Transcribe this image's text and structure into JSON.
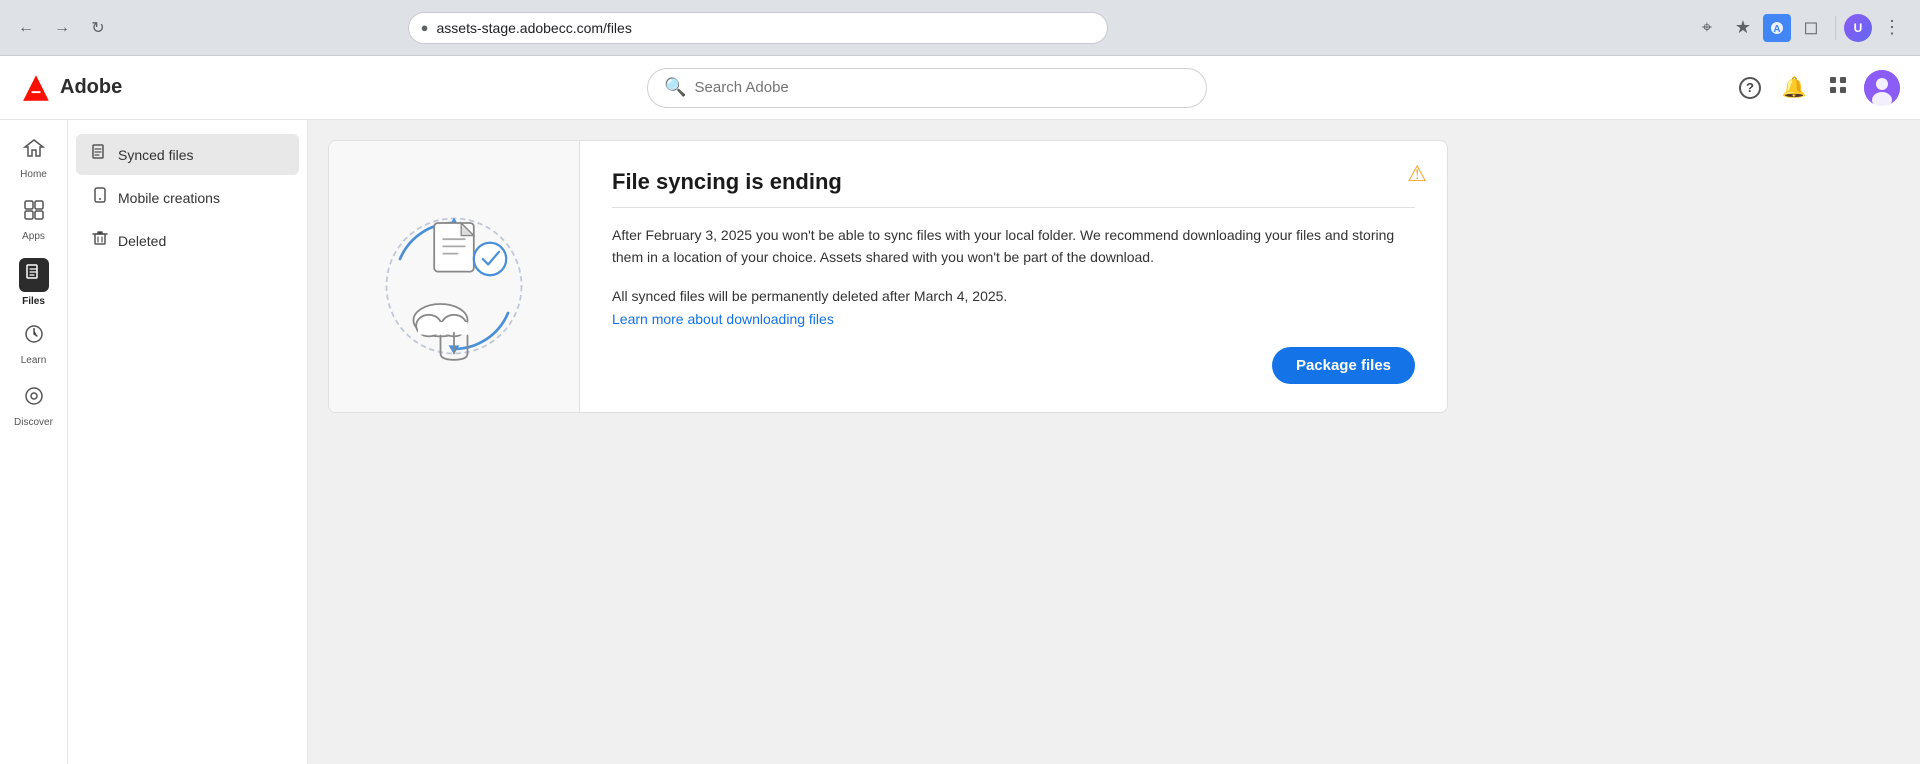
{
  "browser": {
    "back_btn": "←",
    "forward_btn": "→",
    "reload_btn": "↺",
    "address": "assets-stage.adobecc.com/files",
    "address_icon": "🔒",
    "zoom_icon": "⊕",
    "bookmark_icon": "☆",
    "menu_icon": "⋮"
  },
  "top_nav": {
    "logo_text": "Adobe",
    "search_placeholder": "Search Adobe",
    "help_icon": "?",
    "bell_icon": "🔔",
    "grid_icon": "grid"
  },
  "icon_nav": {
    "items": [
      {
        "id": "home",
        "label": "Home",
        "icon": "⌂",
        "active": false
      },
      {
        "id": "apps",
        "label": "Apps",
        "icon": "⊞",
        "active": false
      },
      {
        "id": "files",
        "label": "Files",
        "icon": "📄",
        "active": true
      },
      {
        "id": "learn",
        "label": "Learn",
        "icon": "💡",
        "active": false
      },
      {
        "id": "discover",
        "label": "Discover",
        "icon": "◎",
        "active": false
      }
    ]
  },
  "sub_sidebar": {
    "items": [
      {
        "id": "synced-files",
        "label": "Synced files",
        "icon": "📄",
        "active": true
      },
      {
        "id": "mobile-creations",
        "label": "Mobile creations",
        "icon": "📋",
        "active": false
      },
      {
        "id": "deleted",
        "label": "Deleted",
        "icon": "🗑",
        "active": false
      }
    ]
  },
  "banner": {
    "title": "File syncing is ending",
    "warning_icon": "⚠",
    "text1": "After February 3, 2025 you won't be able to sync files with your local folder. We recommend downloading your files and storing them in a location of your choice. Assets shared with you won't be part of the download.",
    "text2": "All synced files will be permanently deleted after March 4, 2025.",
    "link_text": "Learn more about downloading files",
    "package_btn_label": "Package files"
  }
}
